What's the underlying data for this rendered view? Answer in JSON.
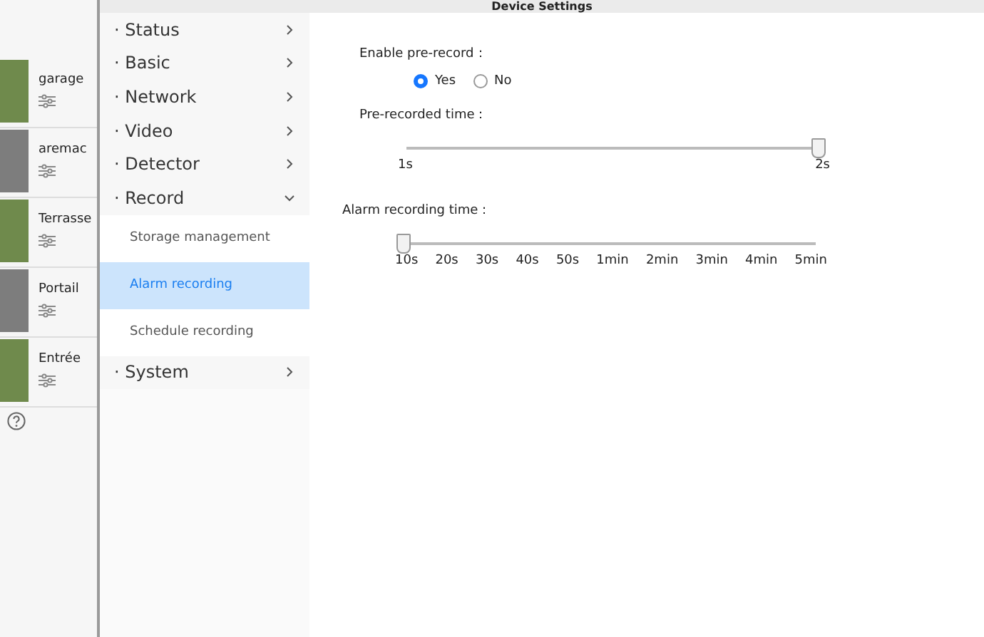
{
  "window": {
    "title": "Device Settings"
  },
  "cameras": [
    {
      "name": "garage"
    },
    {
      "name": "aremac"
    },
    {
      "name": "Terrasse"
    },
    {
      "name": "Portail"
    },
    {
      "name": "Entrée"
    }
  ],
  "menu": [
    {
      "label": "· Status",
      "expanded": false
    },
    {
      "label": "· Basic",
      "expanded": false
    },
    {
      "label": "· Network",
      "expanded": false
    },
    {
      "label": "· Video",
      "expanded": false
    },
    {
      "label": "· Detector",
      "expanded": false
    },
    {
      "label": "· Record",
      "expanded": true,
      "children": [
        {
          "label": "Storage management",
          "selected": false
        },
        {
          "label": "Alarm recording",
          "selected": true
        },
        {
          "label": "Schedule recording",
          "selected": false
        }
      ]
    },
    {
      "label": "· System",
      "expanded": false
    }
  ],
  "enable_prerecord": {
    "label": "Enable pre-record：",
    "options": [
      {
        "label": "Yes",
        "selected": true
      },
      {
        "label": "No",
        "selected": false
      }
    ]
  },
  "prerecorded_time": {
    "label": "Pre-recorded time：",
    "level": 1,
    "ticks": [
      "1s",
      "2s"
    ]
  },
  "alarm_recording_time": {
    "label": "Alarm recording time：",
    "level": 0,
    "ticks": [
      "10s",
      "20s",
      "30s",
      "40s",
      "50s",
      "1min",
      "2min",
      "3min",
      "4min",
      "5min"
    ]
  }
}
